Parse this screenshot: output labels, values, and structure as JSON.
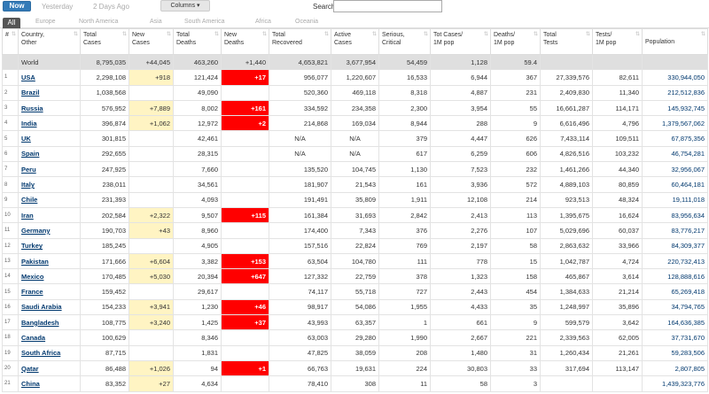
{
  "tabs": {
    "now": "Now",
    "yesterday": "Yesterday",
    "two_days_ago": "2 Days Ago"
  },
  "columns_button": "Columns ▾",
  "search_label": "Search:",
  "search_value": "",
  "regions": [
    "All",
    "Europe",
    "North America",
    "Asia",
    "South America",
    "Africa",
    "Oceania"
  ],
  "headers": [
    [
      "#",
      ""
    ],
    [
      "Country,",
      "Other"
    ],
    [
      "Total",
      "Cases"
    ],
    [
      "New",
      "Cases"
    ],
    [
      "Total",
      "Deaths"
    ],
    [
      "New",
      "Deaths"
    ],
    [
      "Total",
      "Recovered"
    ],
    [
      "Active",
      "Cases"
    ],
    [
      "Serious,",
      "Critical"
    ],
    [
      "Tot Cases/",
      "1M pop"
    ],
    [
      "Deaths/",
      "1M pop"
    ],
    [
      "Total",
      "Tests"
    ],
    [
      "Tests/",
      "1M pop"
    ],
    [
      "Population",
      ""
    ]
  ],
  "world": [
    "",
    "World",
    "8,795,035",
    "+44,045",
    "463,260",
    "+1,440",
    "4,653,821",
    "3,677,954",
    "54,459",
    "1,128",
    "59.4",
    "",
    "",
    ""
  ],
  "rows": [
    [
      "1",
      "USA",
      "2,298,108",
      "+918",
      "121,424",
      "+17",
      "956,077",
      "1,220,607",
      "16,533",
      "6,944",
      "367",
      "27,339,576",
      "82,611",
      "330,944,050"
    ],
    [
      "2",
      "Brazil",
      "1,038,568",
      "",
      "49,090",
      "",
      "520,360",
      "469,118",
      "8,318",
      "4,887",
      "231",
      "2,409,830",
      "11,340",
      "212,512,836"
    ],
    [
      "3",
      "Russia",
      "576,952",
      "+7,889",
      "8,002",
      "+161",
      "334,592",
      "234,358",
      "2,300",
      "3,954",
      "55",
      "16,661,287",
      "114,171",
      "145,932,745"
    ],
    [
      "4",
      "India",
      "396,874",
      "+1,062",
      "12,972",
      "+2",
      "214,868",
      "169,034",
      "8,944",
      "288",
      "9",
      "6,616,496",
      "4,796",
      "1,379,567,062"
    ],
    [
      "5",
      "UK",
      "301,815",
      "",
      "42,461",
      "",
      "N/A",
      "N/A",
      "379",
      "4,447",
      "626",
      "7,433,114",
      "109,511",
      "67,875,356"
    ],
    [
      "6",
      "Spain",
      "292,655",
      "",
      "28,315",
      "",
      "N/A",
      "N/A",
      "617",
      "6,259",
      "606",
      "4,826,516",
      "103,232",
      "46,754,281"
    ],
    [
      "7",
      "Peru",
      "247,925",
      "",
      "7,660",
      "",
      "135,520",
      "104,745",
      "1,130",
      "7,523",
      "232",
      "1,461,266",
      "44,340",
      "32,956,067"
    ],
    [
      "8",
      "Italy",
      "238,011",
      "",
      "34,561",
      "",
      "181,907",
      "21,543",
      "161",
      "3,936",
      "572",
      "4,889,103",
      "80,859",
      "60,464,181"
    ],
    [
      "9",
      "Chile",
      "231,393",
      "",
      "4,093",
      "",
      "191,491",
      "35,809",
      "1,911",
      "12,108",
      "214",
      "923,513",
      "48,324",
      "19,111,018"
    ],
    [
      "10",
      "Iran",
      "202,584",
      "+2,322",
      "9,507",
      "+115",
      "161,384",
      "31,693",
      "2,842",
      "2,413",
      "113",
      "1,395,675",
      "16,624",
      "83,956,634"
    ],
    [
      "11",
      "Germany",
      "190,703",
      "+43",
      "8,960",
      "",
      "174,400",
      "7,343",
      "376",
      "2,276",
      "107",
      "5,029,696",
      "60,037",
      "83,776,217"
    ],
    [
      "12",
      "Turkey",
      "185,245",
      "",
      "4,905",
      "",
      "157,516",
      "22,824",
      "769",
      "2,197",
      "58",
      "2,863,632",
      "33,966",
      "84,309,377"
    ],
    [
      "13",
      "Pakistan",
      "171,666",
      "+6,604",
      "3,382",
      "+153",
      "63,504",
      "104,780",
      "111",
      "778",
      "15",
      "1,042,787",
      "4,724",
      "220,732,413"
    ],
    [
      "14",
      "Mexico",
      "170,485",
      "+5,030",
      "20,394",
      "+647",
      "127,332",
      "22,759",
      "378",
      "1,323",
      "158",
      "465,867",
      "3,614",
      "128,888,616"
    ],
    [
      "15",
      "France",
      "159,452",
      "",
      "29,617",
      "",
      "74,117",
      "55,718",
      "727",
      "2,443",
      "454",
      "1,384,633",
      "21,214",
      "65,269,418"
    ],
    [
      "16",
      "Saudi Arabia",
      "154,233",
      "+3,941",
      "1,230",
      "+46",
      "98,917",
      "54,086",
      "1,955",
      "4,433",
      "35",
      "1,248,997",
      "35,896",
      "34,794,765"
    ],
    [
      "17",
      "Bangladesh",
      "108,775",
      "+3,240",
      "1,425",
      "+37",
      "43,993",
      "63,357",
      "1",
      "661",
      "9",
      "599,579",
      "3,642",
      "164,636,385"
    ],
    [
      "18",
      "Canada",
      "100,629",
      "",
      "8,346",
      "",
      "63,003",
      "29,280",
      "1,990",
      "2,667",
      "221",
      "2,339,563",
      "62,005",
      "37,731,670"
    ],
    [
      "19",
      "South Africa",
      "87,715",
      "",
      "1,831",
      "",
      "47,825",
      "38,059",
      "208",
      "1,480",
      "31",
      "1,260,434",
      "21,261",
      "59,283,506"
    ],
    [
      "20",
      "Qatar",
      "86,488",
      "+1,026",
      "94",
      "+1",
      "66,763",
      "19,631",
      "224",
      "30,803",
      "33",
      "317,694",
      "113,147",
      "2,807,805"
    ],
    [
      "21",
      "China",
      "83,352",
      "+27",
      "4,634",
      "",
      "78,410",
      "308",
      "11",
      "58",
      "3",
      "",
      "",
      "1,439,323,776"
    ]
  ],
  "colors": {
    "now_button": "#337ab7",
    "new_cases_highlight": "#fff4c3",
    "new_deaths_highlight": "#ff0000",
    "world_row": "#dfdfdf",
    "link": "#00386e"
  },
  "icons": {
    "sort": "sort-arrows-icon",
    "caret": "caret-down-icon"
  }
}
